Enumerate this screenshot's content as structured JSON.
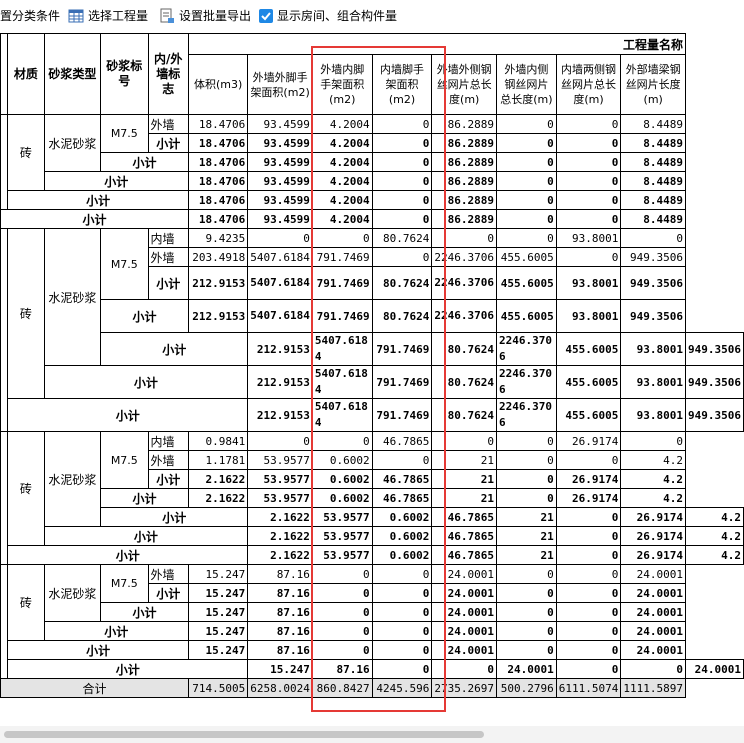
{
  "toolbar": {
    "items": [
      {
        "label": "置分类条件"
      },
      {
        "label": "选择工程量"
      },
      {
        "label": "设置批量导出"
      },
      {
        "label": "显示房间、组合构件量",
        "checked": true
      }
    ]
  },
  "colors": {
    "highlight_box": "#e53935",
    "total_row_bg": "#e4e4e4",
    "checkbox": "#1e88e5"
  },
  "table": {
    "header": {
      "group": "工程量名称",
      "material": "材质",
      "mortar_type": "砂浆类型",
      "mortar_grade": "砂浆标号",
      "inout": "内/外墙标志",
      "cols": [
        "体积(m3)",
        "外墙外脚手架面积(m2)",
        "外墙内脚手架面积(m2)",
        "内墙脚手架面积(m2)",
        "外墙外侧钢丝网片总长度(m)",
        "外墙内侧钢丝网片总长度(m)",
        "内墙两侧钢丝网片总长度(m)",
        "外部墙梁钢丝网片长度(m)"
      ]
    },
    "labels": {
      "brick": "砖",
      "cement_mortar": "水泥砂浆",
      "grade": "M7.5",
      "outer": "外墙",
      "inner": "内墙",
      "subtotal": "小计",
      "total": "合计"
    },
    "g1": {
      "outer": [
        "18.4706",
        "93.4599",
        "4.2004",
        "0",
        "86.2889",
        "0",
        "0",
        "8.4489"
      ],
      "sum": [
        "18.4706",
        "93.4599",
        "4.2004",
        "0",
        "86.2889",
        "0",
        "0",
        "8.4489"
      ]
    },
    "g2": {
      "inner": [
        "9.4235",
        "0",
        "0",
        "80.7624",
        "0",
        "0",
        "93.8001",
        "0"
      ],
      "outer": [
        "203.4918",
        "5407.6184",
        "791.7469",
        "0",
        "2246.3706",
        "455.6005",
        "0",
        "949.3506"
      ],
      "sum": [
        "212.9153",
        "5407.6184",
        "791.7469",
        "80.7624",
        "2246.3706",
        "455.6005",
        "93.8001",
        "949.3506"
      ]
    },
    "g3": {
      "inner": [
        "0.9841",
        "0",
        "0",
        "46.7865",
        "0",
        "0",
        "26.9174",
        "0"
      ],
      "outer": [
        "1.1781",
        "53.9577",
        "0.6002",
        "0",
        "21",
        "0",
        "0",
        "4.2"
      ],
      "sum": [
        "2.1622",
        "53.9577",
        "0.6002",
        "46.7865",
        "21",
        "0",
        "26.9174",
        "4.2"
      ]
    },
    "g4": {
      "outer": [
        "15.247",
        "87.16",
        "0",
        "0",
        "24.0001",
        "0",
        "0",
        "24.0001"
      ],
      "sum": [
        "15.247",
        "87.16",
        "0",
        "0",
        "24.0001",
        "0",
        "0",
        "24.0001"
      ]
    },
    "total": [
      "714.5005",
      "6258.0024",
      "860.8427",
      "4245.596",
      "2735.2697",
      "500.2796",
      "6111.5074",
      "1111.5897"
    ]
  }
}
